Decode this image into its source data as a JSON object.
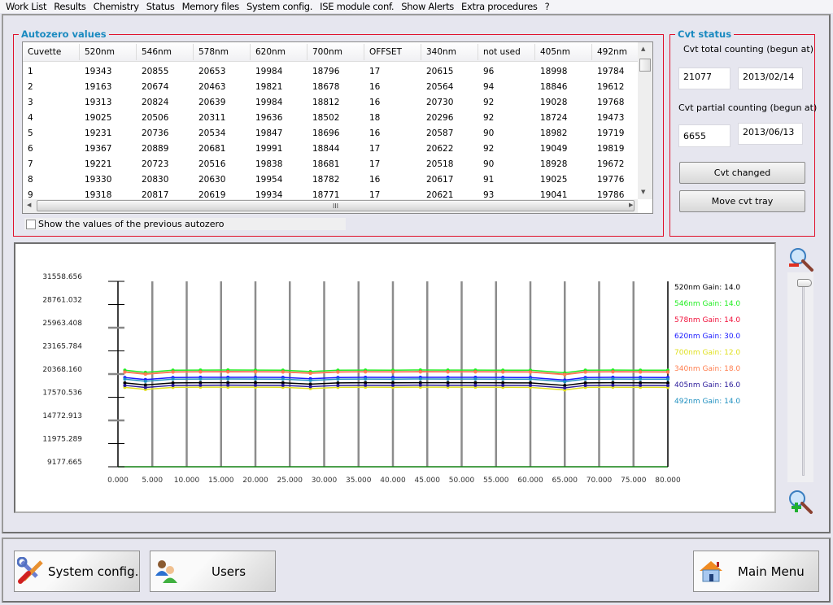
{
  "menu": [
    "Work List",
    "Results",
    "Chemistry",
    "Status",
    "Memory files",
    "System config.",
    "ISE module conf.",
    "Show Alerts",
    "Extra procedures",
    "?"
  ],
  "autozero": {
    "title": "Autozero values",
    "columns": [
      "Cuvette",
      "520nm",
      "546nm",
      "578nm",
      "620nm",
      "700nm",
      "OFFSET",
      "340nm",
      "not used",
      "405nm",
      "492nm"
    ],
    "rows": [
      [
        "1",
        "19343",
        "20855",
        "20653",
        "19984",
        "18796",
        "17",
        "20615",
        "96",
        "18998",
        "19784"
      ],
      [
        "2",
        "19163",
        "20674",
        "20463",
        "19821",
        "18678",
        "16",
        "20564",
        "94",
        "18846",
        "19612"
      ],
      [
        "3",
        "19313",
        "20824",
        "20639",
        "19984",
        "18812",
        "16",
        "20730",
        "92",
        "19028",
        "19768"
      ],
      [
        "4",
        "19025",
        "20506",
        "20311",
        "19636",
        "18502",
        "18",
        "20296",
        "92",
        "18724",
        "19473"
      ],
      [
        "5",
        "19231",
        "20736",
        "20534",
        "19847",
        "18696",
        "16",
        "20587",
        "90",
        "18982",
        "19719"
      ],
      [
        "6",
        "19367",
        "20889",
        "20681",
        "19991",
        "18844",
        "17",
        "20622",
        "92",
        "19049",
        "19819"
      ],
      [
        "7",
        "19221",
        "20723",
        "20516",
        "19838",
        "18681",
        "17",
        "20518",
        "90",
        "18928",
        "19672"
      ],
      [
        "8",
        "19330",
        "20830",
        "20630",
        "19954",
        "18782",
        "16",
        "20617",
        "91",
        "19025",
        "19776"
      ],
      [
        "9",
        "19318",
        "20817",
        "20619",
        "19934",
        "18771",
        "17",
        "20621",
        "93",
        "19041",
        "19786"
      ]
    ],
    "show_previous_label": "Show the values of the previous autozero",
    "show_previous_checked": false
  },
  "cvt": {
    "title": "Cvt status",
    "total_label": "Cvt total counting (begun at)",
    "total_count": "21077",
    "total_date": "2013/02/14",
    "partial_label": "Cvt partial counting (begun at)",
    "partial_count": "6655",
    "partial_date": "2013/06/13",
    "changed_button": "Cvt changed",
    "move_button": "Move cvt tray"
  },
  "bottom": {
    "system_config": "System config.",
    "users": "Users",
    "main_menu": "Main Menu"
  },
  "chart_data": {
    "type": "line",
    "ylim": [
      9177.665,
      31558.656
    ],
    "xlim": [
      0,
      80
    ],
    "ytick_labels": [
      "31558.656",
      "28761.032",
      "25963.408",
      "23165.784",
      "20368.160",
      "17570.536",
      "14772.913",
      "11975.289",
      "9177.665"
    ],
    "xtick_labels": [
      "0.000",
      "5.000",
      "10.000",
      "15.000",
      "20.000",
      "25.000",
      "30.000",
      "35.000",
      "40.000",
      "45.000",
      "50.000",
      "55.000",
      "60.000",
      "65.000",
      "70.000",
      "75.000",
      "80.000"
    ],
    "grid": "vertical",
    "legend_placement": "right",
    "x": [
      1,
      4,
      8,
      12,
      16,
      20,
      24,
      28,
      32,
      36,
      40,
      44,
      48,
      52,
      56,
      60,
      65,
      68,
      72,
      76,
      80
    ],
    "series": [
      {
        "name": "520nm Gain: 14.0",
        "color": "#000000",
        "values": [
          19300,
          19050,
          19300,
          19320,
          19330,
          19320,
          19310,
          19150,
          19300,
          19320,
          19310,
          19330,
          19320,
          19320,
          19310,
          19300,
          19000,
          19300,
          19320,
          19310,
          19300
        ]
      },
      {
        "name": "546nm Gain: 14.0",
        "color": "#22ee22",
        "values": [
          20830,
          20580,
          20830,
          20850,
          20860,
          20850,
          20840,
          20680,
          20830,
          20850,
          20840,
          20860,
          20850,
          20850,
          20840,
          20830,
          20530,
          20830,
          20850,
          20840,
          20830
        ]
      },
      {
        "name": "578nm Gain: 14.0",
        "color": "#f0103a",
        "values": [
          20630,
          20380,
          20630,
          20650,
          20660,
          20650,
          20640,
          20480,
          20630,
          20650,
          20640,
          20660,
          20650,
          20650,
          20640,
          20630,
          20330,
          20630,
          20650,
          20640,
          20630
        ]
      },
      {
        "name": "620nm Gain: 30.0",
        "color": "#1a1aff",
        "values": [
          19950,
          19700,
          19950,
          19970,
          19980,
          19970,
          19960,
          19800,
          19950,
          19970,
          19960,
          19980,
          19970,
          19970,
          19960,
          19950,
          19650,
          19950,
          19970,
          19960,
          19950
        ]
      },
      {
        "name": "700nm Gain: 12.0",
        "color": "#e0e020",
        "values": [
          18760,
          18510,
          18760,
          18780,
          18790,
          18780,
          18770,
          18610,
          18760,
          18780,
          18770,
          18790,
          18780,
          18780,
          18770,
          18760,
          18460,
          18760,
          18780,
          18770,
          18760
        ]
      },
      {
        "name": "340nm Gain: 18.0",
        "color": "#ff7f50",
        "values": [
          20600,
          20350,
          20600,
          20620,
          20630,
          20620,
          20610,
          20450,
          20600,
          20620,
          20610,
          20630,
          20620,
          20620,
          20610,
          20600,
          20300,
          20600,
          20620,
          20610,
          20600
        ]
      },
      {
        "name": "405nm Gain: 16.0",
        "color": "#2a1a9a",
        "values": [
          19000,
          18750,
          19000,
          19020,
          19030,
          19020,
          19010,
          18850,
          19000,
          19020,
          19010,
          19030,
          19020,
          19020,
          19010,
          19000,
          18700,
          19000,
          19020,
          19010,
          19000
        ]
      },
      {
        "name": "492nm Gain: 14.0",
        "color": "#2090c0",
        "values": [
          19750,
          19500,
          19750,
          19770,
          19780,
          19770,
          19760,
          19600,
          19750,
          19770,
          19760,
          19780,
          19770,
          19770,
          19760,
          19750,
          19450,
          19750,
          19770,
          19760,
          19750
        ]
      }
    ]
  }
}
